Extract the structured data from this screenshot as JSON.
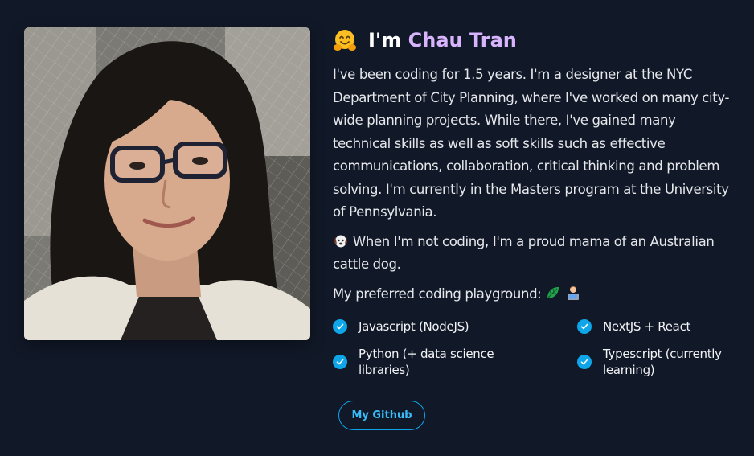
{
  "profile": {
    "greeting": "I'm",
    "name": "Chau Tran",
    "photo_alt": "Portrait of Chau Tran"
  },
  "bio": {
    "paragraph_1": "I've been coding for 1.5 years. I'm a designer at the NYC Department of City Planning, where I've worked on many city-wide planning projects. While there, I've gained many technical skills as well as soft skills such as effective communications, collaboration, critical thinking and problem solving. I'm currently in the Masters program at the University of Pennsylvania.",
    "paragraph_2": "When I'm not coding, I'm a proud mama of an Australian cattle dog.",
    "paragraph_3": "My preferred coding playground:"
  },
  "skills": [
    {
      "label": "Javascript (NodeJS)"
    },
    {
      "label": "NextJS + React"
    },
    {
      "label": "Python (+ data science libraries)"
    },
    {
      "label": "Typescript (currently learning)"
    }
  ],
  "github_button": {
    "label": "My Github"
  },
  "icons": {
    "title_emoji": "hugging-face-emoji-icon",
    "dog_emoji": "dog-face-emoji-icon",
    "playground_1": "leafy-green-emoji-icon",
    "playground_2": "technologist-emoji-icon",
    "check": "check-circle-icon"
  },
  "colors": {
    "background": "#111827",
    "name_accent": "#d8b4fe",
    "check_accent": "#0ea5e9",
    "button_text": "#38bdf8"
  }
}
